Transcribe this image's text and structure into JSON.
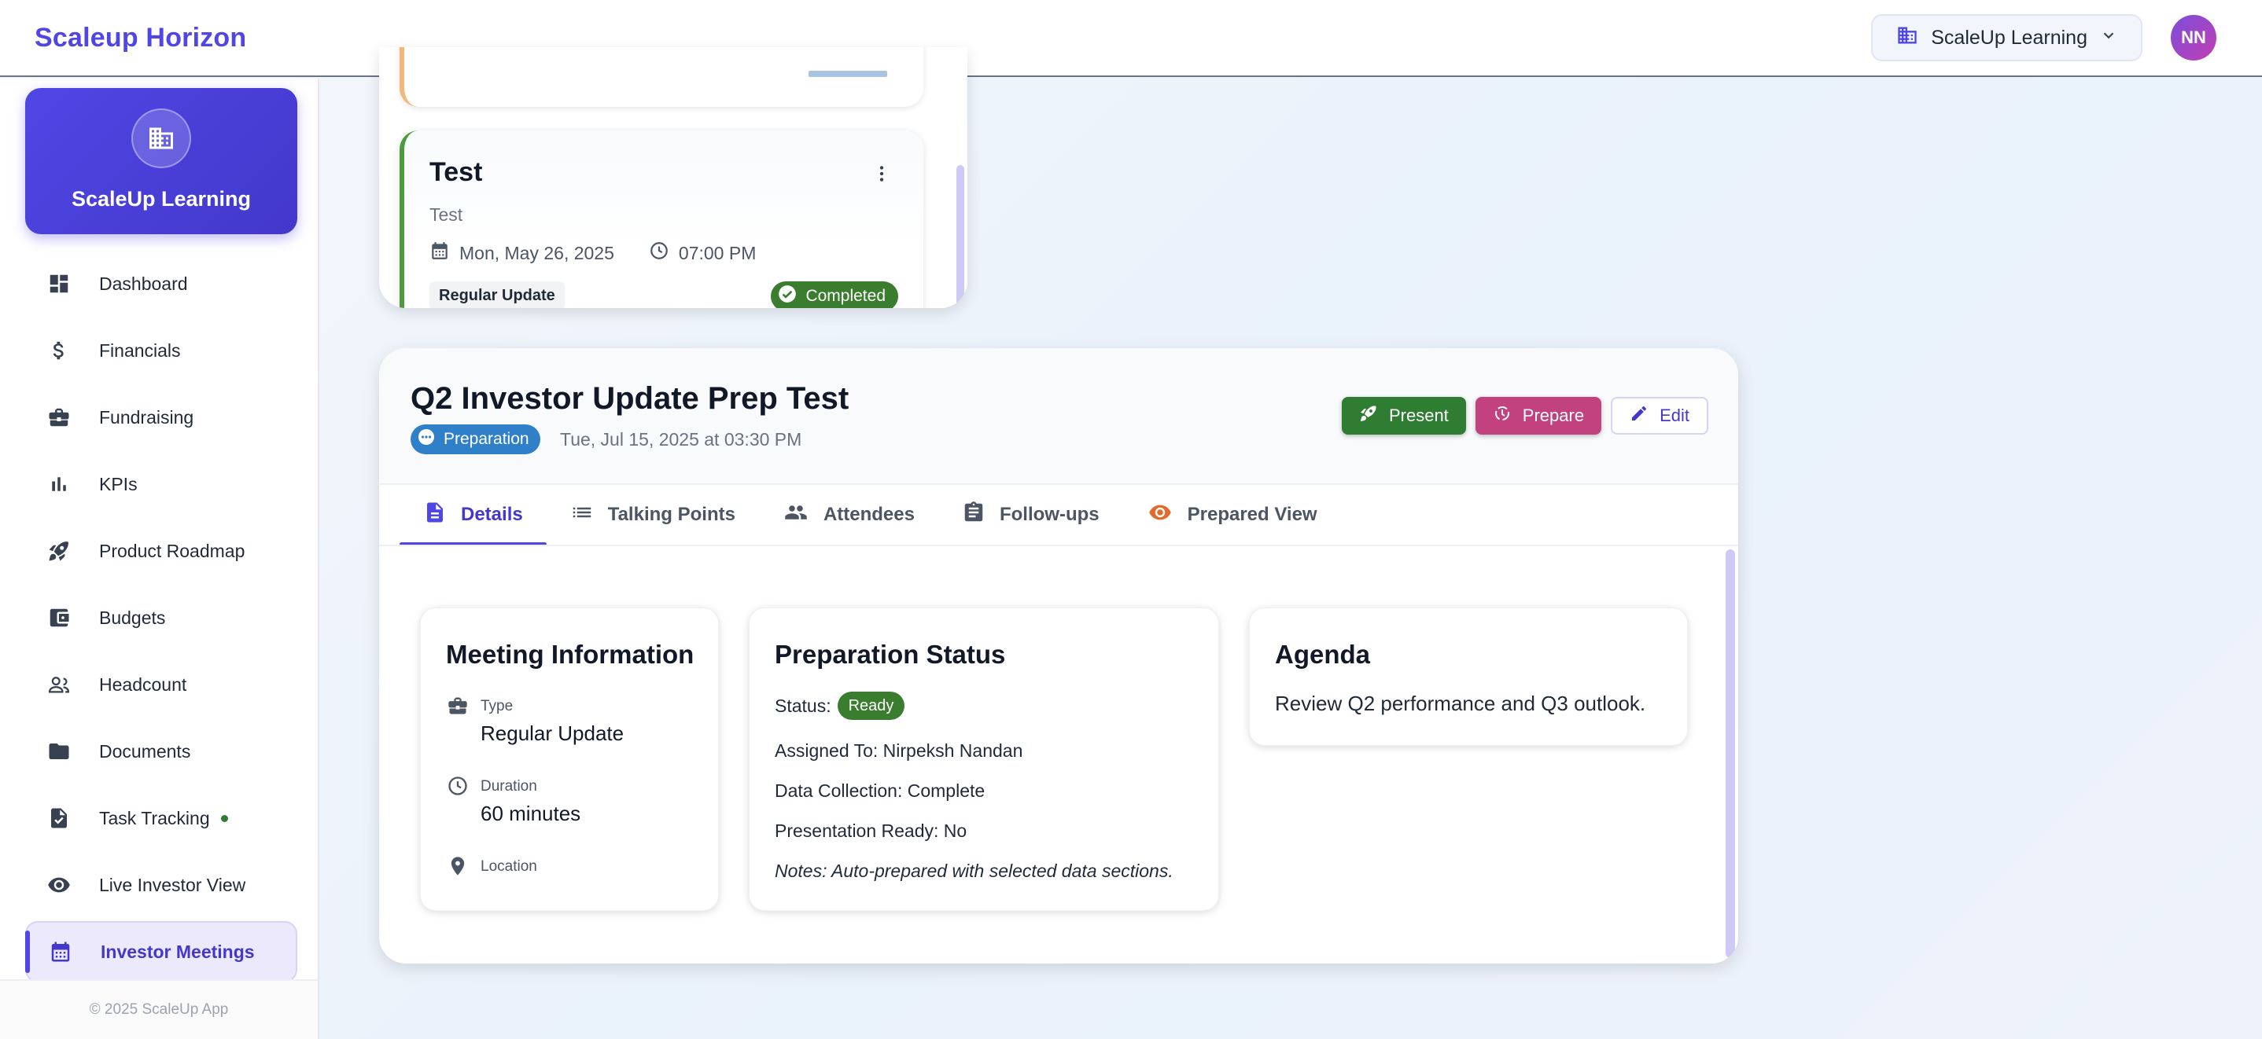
{
  "header": {
    "brand": "Scaleup Horizon",
    "org_selector": "ScaleUp Learning",
    "avatar_initials": "NN"
  },
  "sidebar": {
    "org_name": "ScaleUp Learning",
    "items": [
      {
        "label": "Dashboard",
        "icon": "dashboard-icon"
      },
      {
        "label": "Financials",
        "icon": "dollar-icon"
      },
      {
        "label": "Fundraising",
        "icon": "briefcase-icon"
      },
      {
        "label": "KPIs",
        "icon": "bar-chart-icon"
      },
      {
        "label": "Product Roadmap",
        "icon": "rocket-icon"
      },
      {
        "label": "Budgets",
        "icon": "wallet-icon"
      },
      {
        "label": "Headcount",
        "icon": "people-icon"
      },
      {
        "label": "Documents",
        "icon": "folder-icon"
      },
      {
        "label": "Task Tracking",
        "icon": "task-icon"
      },
      {
        "label": "Live Investor View",
        "icon": "eye-icon"
      },
      {
        "label": "Investor Meetings",
        "icon": "calendar-icon"
      }
    ],
    "footer": "© 2025 ScaleUp App"
  },
  "meeting_list": {
    "card": {
      "title": "Test",
      "subtitle": "Test",
      "date": "Mon, May 26, 2025",
      "time": "07:00 PM",
      "type": "Regular Update",
      "status": "Completed"
    }
  },
  "detail": {
    "title": "Q2 Investor Update Prep Test",
    "status": "Preparation",
    "datetime": "Tue, Jul 15, 2025 at 03:30 PM",
    "actions": {
      "present": "Present",
      "prepare": "Prepare",
      "edit": "Edit"
    },
    "tabs": [
      {
        "label": "Details",
        "icon": "document-icon"
      },
      {
        "label": "Talking Points",
        "icon": "list-icon"
      },
      {
        "label": "Attendees",
        "icon": "people-icon"
      },
      {
        "label": "Follow-ups",
        "icon": "clipboard-icon"
      },
      {
        "label": "Prepared View",
        "icon": "eye-icon"
      }
    ],
    "meeting_info": {
      "title": "Meeting Information",
      "type_label": "Type",
      "type_value": "Regular Update",
      "duration_label": "Duration",
      "duration_value": "60 minutes",
      "location_label": "Location"
    },
    "prep_status": {
      "title": "Preparation Status",
      "status_label": "Status:",
      "status_value": "Ready",
      "assigned": "Assigned To: Nirpeksh Nandan",
      "data_collection": "Data Collection: Complete",
      "presentation_ready": "Presentation Ready: No",
      "notes": "Notes: Auto-prepared with selected data sections."
    },
    "agenda": {
      "title": "Agenda",
      "text": "Review Q2 performance and Q3 outlook."
    }
  },
  "colors": {
    "brand": "#4f46e5",
    "success": "#2e7d32",
    "prepare": "#c2417f",
    "info": "#2f80c9"
  }
}
